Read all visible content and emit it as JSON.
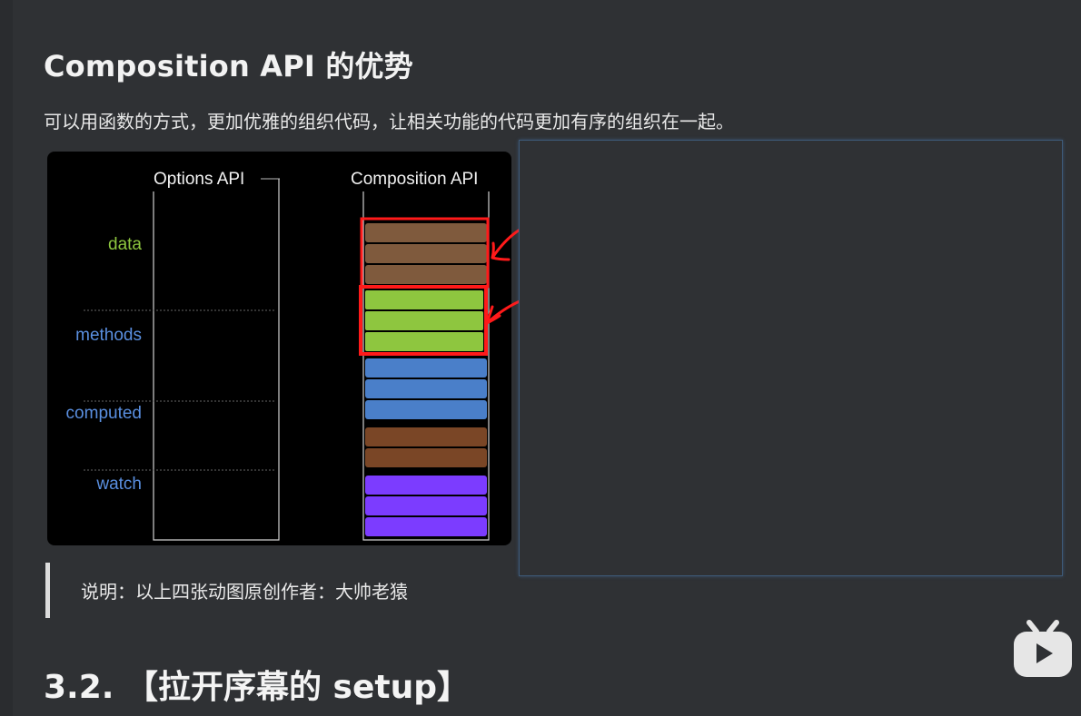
{
  "section": {
    "title": "Composition API 的优势",
    "description": "可以用函数的方式，更加优雅的组织代码，让相关功能的代码更加有序的组织在一起。"
  },
  "figure": {
    "options_label": "Options API",
    "composition_label": "Composition API",
    "row_labels": {
      "data": "data",
      "methods": "methods",
      "computed": "computed",
      "watch": "watch"
    },
    "colors": {
      "data": "#7f5a3d",
      "methods": "#8ec63f",
      "computed": "#4a7fc9",
      "computed_dark": "#7a4626",
      "watch": "#7c3cff",
      "label_green": "#8dc63f",
      "label_blue": "#5a8fe0",
      "annotation_red": "#ff1a1a"
    }
  },
  "quote": {
    "text": "说明：以上四张动图原创作者：大帅老猿"
  },
  "next_section": {
    "title": "3.2. 【拉开序幕的 setup】"
  },
  "logo": {
    "icon": "bilibili-tv-icon"
  }
}
